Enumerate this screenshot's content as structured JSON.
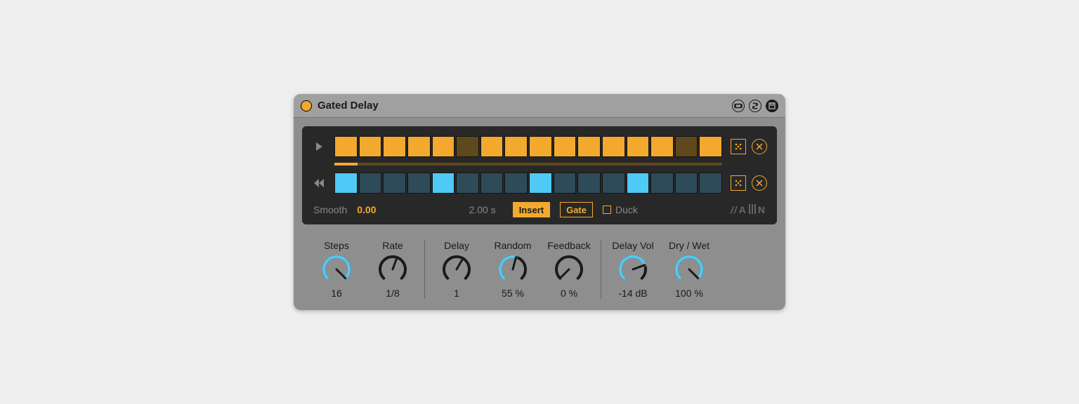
{
  "title": "Gated Delay",
  "colors": {
    "accent_orange": "#f3a92e",
    "accent_blue": "#4fc9f5"
  },
  "sequencer": {
    "progress_percent": 6,
    "row1": [
      true,
      true,
      true,
      true,
      true,
      false,
      true,
      true,
      true,
      true,
      true,
      true,
      true,
      true,
      false,
      true
    ],
    "row2": [
      true,
      false,
      false,
      false,
      true,
      false,
      false,
      false,
      true,
      false,
      false,
      false,
      true,
      false,
      false,
      false
    ]
  },
  "bottom": {
    "smooth_label": "Smooth",
    "smooth_value": "0.00",
    "time_value": "2.00 s",
    "insert_label": "Insert",
    "gate_label": "Gate",
    "duck_label": "Duck",
    "duck_checked": false,
    "brand": "A|||N"
  },
  "knobs": [
    {
      "group": 0,
      "label": "Steps",
      "value": "16",
      "angle": 135,
      "color": "#4fc9f5",
      "sweep": 270
    },
    {
      "group": 0,
      "label": "Rate",
      "value": "1/8",
      "angle": 20,
      "color": "#1a1a1a",
      "sweep": 0
    },
    {
      "group": 1,
      "label": "Delay",
      "value": "1",
      "angle": 30,
      "color": "#1a1a1a",
      "sweep": 0
    },
    {
      "group": 1,
      "label": "Random",
      "value": "55 %",
      "angle": 15,
      "color": "#4fc9f5",
      "sweep": 150
    },
    {
      "group": 1,
      "label": "Feedback",
      "value": "0 %",
      "angle": -135,
      "color": "#1a1a1a",
      "sweep": 0
    },
    {
      "group": 2,
      "label": "Delay Vol",
      "value": "-14 dB",
      "angle": 70,
      "color": "#4fc9f5",
      "sweep": 205
    },
    {
      "group": 2,
      "label": "Dry / Wet",
      "value": "100 %",
      "angle": 135,
      "color": "#4fc9f5",
      "sweep": 270
    }
  ]
}
